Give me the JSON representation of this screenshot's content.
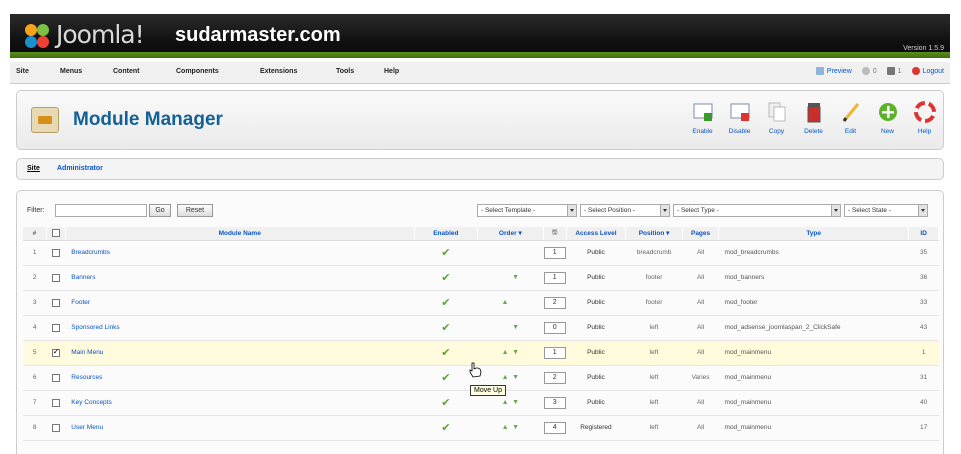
{
  "header": {
    "logo_text": "Joomla!",
    "site": "sudarmaster.com",
    "version": "Version 1.5.9"
  },
  "menu": {
    "items": [
      "Site",
      "Menus",
      "Content",
      "Components",
      "Extensions",
      "Tools",
      "Help"
    ],
    "preview": "Preview",
    "messages": "0",
    "users": "1",
    "logout": "Logout"
  },
  "title": "Module Manager",
  "toolbar": [
    "Enable",
    "Disable",
    "Copy",
    "Delete",
    "Edit",
    "New",
    "Help"
  ],
  "tabs": {
    "site": "Site",
    "admin": "Administrator"
  },
  "filters": {
    "filter_label": "Filter:",
    "go": "Go",
    "reset": "Reset",
    "template": "- Select Template -",
    "position": "- Select Position -",
    "type": "- Select Type -",
    "state": "- Select State -"
  },
  "columns": {
    "num": "#",
    "name": "Module Name",
    "enabled": "Enabled",
    "order": "Order",
    "access": "Access Level",
    "position": "Position",
    "pages": "Pages",
    "type": "Type",
    "id": "ID"
  },
  "rows": [
    {
      "num": "1",
      "name": "Breadcrumbs",
      "order": "1",
      "access": "Public",
      "position": "breadcrumb",
      "pages": "All",
      "type": "mod_breadcrumbs",
      "id": "35",
      "checked": false,
      "up": false,
      "down": false
    },
    {
      "num": "2",
      "name": "Banners",
      "order": "1",
      "access": "Public",
      "position": "footer",
      "pages": "All",
      "type": "mod_banners",
      "id": "36",
      "checked": false,
      "up": false,
      "down": true
    },
    {
      "num": "3",
      "name": "Footer",
      "order": "2",
      "access": "Public",
      "position": "footer",
      "pages": "All",
      "type": "mod_footer",
      "id": "33",
      "checked": false,
      "up": true,
      "down": false
    },
    {
      "num": "4",
      "name": "Sponsored Links",
      "order": "0",
      "access": "Public",
      "position": "left",
      "pages": "All",
      "type": "mod_adsense_joomlaspan_2_ClickSafe",
      "id": "43",
      "checked": false,
      "up": false,
      "down": true
    },
    {
      "num": "5",
      "name": "Main Menu",
      "order": "1",
      "access": "Public",
      "position": "left",
      "pages": "All",
      "type": "mod_mainmenu",
      "id": "1",
      "checked": true,
      "up": true,
      "down": true
    },
    {
      "num": "6",
      "name": "Resources",
      "order": "2",
      "access": "Public",
      "position": "left",
      "pages": "Varies",
      "type": "mod_mainmenu",
      "id": "31",
      "checked": false,
      "up": true,
      "down": true
    },
    {
      "num": "7",
      "name": "Key Concepts",
      "order": "3",
      "access": "Public",
      "position": "left",
      "pages": "All",
      "type": "mod_mainmenu",
      "id": "40",
      "checked": false,
      "up": true,
      "down": true
    },
    {
      "num": "8",
      "name": "User Menu",
      "order": "4",
      "access": "Registered",
      "position": "left",
      "pages": "All",
      "type": "mod_mainmenu",
      "id": "17",
      "checked": false,
      "up": true,
      "down": true
    }
  ],
  "tooltip": "Move Up"
}
